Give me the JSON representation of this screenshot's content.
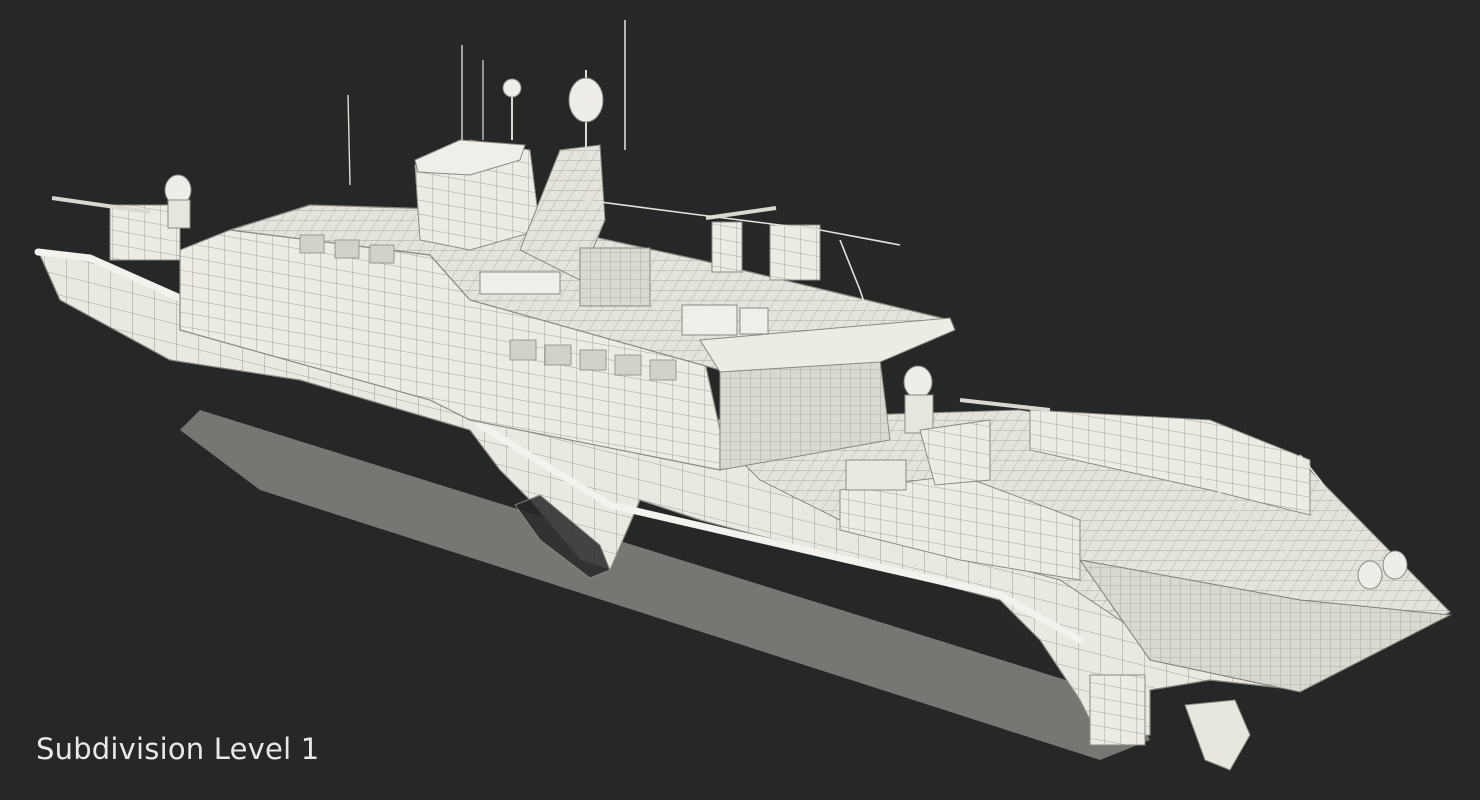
{
  "scene": {
    "background_color": "#262727",
    "model_color": "#ecebe4",
    "wire_color": "#7d7d76"
  },
  "caption": {
    "text": "Subdivision Level 1"
  }
}
